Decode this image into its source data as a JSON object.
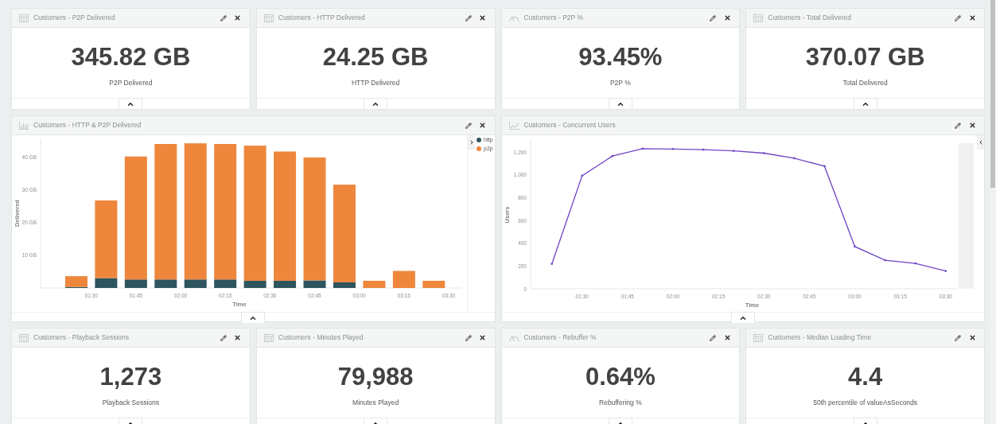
{
  "panels": [
    {
      "kind": "metric",
      "title": "Customers - P2P Delivered",
      "value": "345.82 GB",
      "label": "P2P Delivered"
    },
    {
      "kind": "metric",
      "title": "Customers - HTTP Delivered",
      "value": "24.25 GB",
      "label": "HTTP Delivered"
    },
    {
      "kind": "gauge",
      "title": "Customers - P2P %",
      "value": "93.45%",
      "label": "P2P %"
    },
    {
      "kind": "metric",
      "title": "Customers - Total Delivered",
      "value": "370.07 GB",
      "label": "Total Delivered"
    },
    {
      "kind": "bar_chart",
      "title": "Customers - HTTP & P2P Delivered",
      "chart_data": {
        "type": "bar",
        "stacked": true,
        "xlabel": "Time",
        "ylabel": "Delivered",
        "x": [
          85,
          95,
          105,
          115,
          125,
          135,
          145,
          155,
          165,
          175,
          185,
          195,
          205
        ],
        "xlim": [
          73,
          214
        ],
        "ylim": [
          0,
          45.6
        ],
        "xticks": [
          {
            "value": 90,
            "label": "01:30"
          },
          {
            "value": 105,
            "label": "01:45"
          },
          {
            "value": 120,
            "label": "02:00"
          },
          {
            "value": 135,
            "label": "02:15"
          },
          {
            "value": 150,
            "label": "02:30"
          },
          {
            "value": 165,
            "label": "02:45"
          },
          {
            "value": 180,
            "label": "03:00"
          },
          {
            "value": 195,
            "label": "03:15"
          },
          {
            "value": 210,
            "label": "03:30"
          }
        ],
        "yticks": [
          {
            "value": 10,
            "label": "10 GB"
          },
          {
            "value": 20,
            "label": "20 GB"
          },
          {
            "value": 30,
            "label": "30 GB"
          },
          {
            "value": 40,
            "label": "40 GB"
          }
        ],
        "series": [
          {
            "name": "http",
            "color": "#2e555e",
            "values": [
              0.3,
              3.0,
              2.6,
              2.6,
              2.6,
              2.6,
              2.2,
              2.2,
              2.3,
              1.7,
              0,
              0,
              0
            ]
          },
          {
            "name": "p2p",
            "color": "#ee873c",
            "values": [
              3.3,
              23.7,
              37.5,
              41.3,
              41.5,
              41.3,
              41.2,
              39.4,
              37.5,
              29.8,
              2.2,
              5.2,
              2.2
            ]
          }
        ]
      }
    },
    {
      "kind": "line_chart",
      "title": "Customers - Concurrent Users",
      "chart_data": {
        "type": "line",
        "xlabel": "Time",
        "ylabel": "Users",
        "x": [
          80,
          90,
          100,
          110,
          120,
          130,
          140,
          150,
          160,
          170,
          180,
          190,
          200,
          210
        ],
        "xlim": [
          73,
          214
        ],
        "ylim": [
          0,
          1300
        ],
        "xticks": [
          {
            "value": 90,
            "label": "01:30"
          },
          {
            "value": 105,
            "label": "01:45"
          },
          {
            "value": 120,
            "label": "02:00"
          },
          {
            "value": 135,
            "label": "02:15"
          },
          {
            "value": 150,
            "label": "02:30"
          },
          {
            "value": 165,
            "label": "02:45"
          },
          {
            "value": 180,
            "label": "03:00"
          },
          {
            "value": 195,
            "label": "03:15"
          },
          {
            "value": 210,
            "label": "03:30"
          }
        ],
        "yticks": [
          {
            "value": 0,
            "label": "0"
          },
          {
            "value": 200,
            "label": "200"
          },
          {
            "value": 400,
            "label": "400"
          },
          {
            "value": 600,
            "label": "600"
          },
          {
            "value": 800,
            "label": "800"
          },
          {
            "value": 1000,
            "label": "1,000"
          },
          {
            "value": 1200,
            "label": "1,200"
          }
        ],
        "series": [
          {
            "color": "#6e45c4",
            "values": [
              218,
              993,
              1166,
              1231,
              1228,
              1222,
              1211,
              1192,
              1147,
              1077,
              371,
              251,
              223,
              156
            ]
          }
        ]
      }
    },
    {
      "kind": "metric",
      "title": "Customers - Playback Sessions",
      "value": "1,273",
      "label": "Playback Sessions"
    },
    {
      "kind": "metric",
      "title": "Customers - Minutes Played",
      "value": "79,988",
      "label": "Minutes Played"
    },
    {
      "kind": "gauge",
      "title": "Customers - Rebuffer %",
      "value": "0.64%",
      "label": "Rebuffering %"
    },
    {
      "kind": "metric",
      "title": "Customers - Median Loading Time",
      "value": "4.4",
      "label": "50th percentile of valueAsSeconds"
    }
  ]
}
